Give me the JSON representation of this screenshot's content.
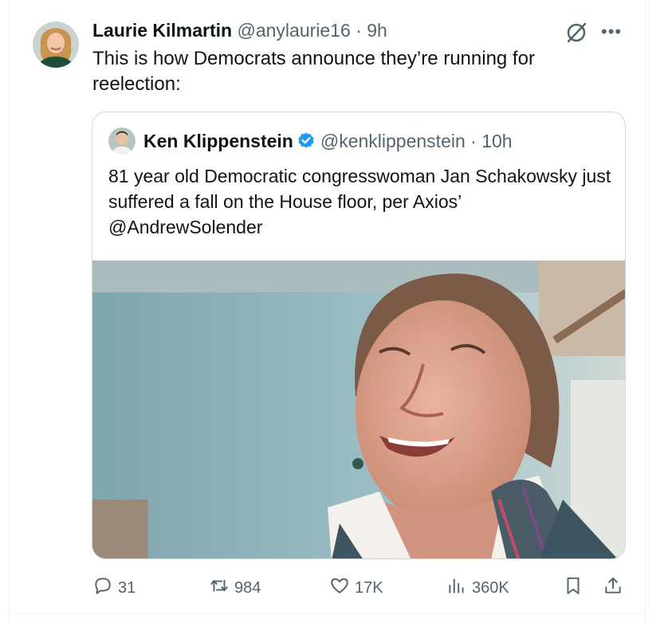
{
  "tweet": {
    "author_name": "Laurie Kilmartin",
    "author_handle": "@anylaurie16",
    "time": "9h",
    "text": "This is how Democrats announce they’re running for reelection:"
  },
  "quoted": {
    "author_name": "Ken Klippenstein",
    "author_handle": "@kenklippenstein",
    "time": "10h",
    "text": "81 year old Democratic congresswoman Jan Schakowsky just suffered a fall on the House floor, per Axios’ @AndrewSolender"
  },
  "actions": {
    "replies": "31",
    "reposts": "984",
    "likes": "17K",
    "views": "360K"
  },
  "icons": {
    "reply": "reply-icon",
    "repost": "repost-icon",
    "like": "heart-icon",
    "views": "views-icon",
    "bookmark": "bookmark-icon",
    "share": "share-icon",
    "grok": "grok-icon",
    "more": "more-icon",
    "verified": "verified-badge-icon"
  },
  "colors": {
    "text": "#0f1419",
    "secondary": "#536471",
    "verified": "#1d9bf0",
    "border": "#cfd9de"
  }
}
